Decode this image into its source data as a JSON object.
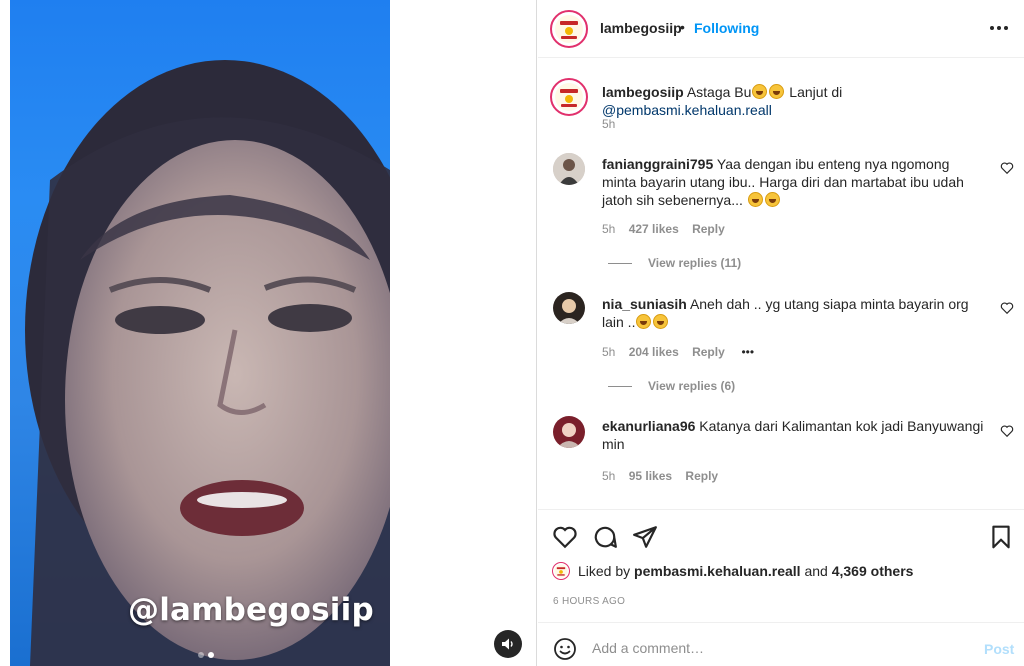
{
  "media": {
    "watermark": "@lambegosiip",
    "carousel_count": 2,
    "carousel_active_index": 1
  },
  "header": {
    "username": "lambegosiip",
    "separator": "•",
    "follow_status": "Following"
  },
  "caption": {
    "username": "lambegosiip",
    "text_before": "Astaga Bu",
    "text_after": " Lanjut di ",
    "mention": "@pembasmi.kehaluan.reall",
    "time": "5h"
  },
  "comments": [
    {
      "username": "fanianggraini795",
      "text": "Yaa dengan ibu enteng nya ngomong minta bayarin utang ibu.. Harga diri dan martabat ibu udah jatoh sih sebenernya...",
      "time": "5h",
      "likes": "427 likes",
      "reply_label": "Reply",
      "view_replies": "View replies (11)"
    },
    {
      "username": "nia_suniasih",
      "text": "Aneh dah .. yg utang siapa minta bayarin org lain ..",
      "time": "5h",
      "likes": "204 likes",
      "reply_label": "Reply",
      "more": "•••",
      "view_replies": "View replies (6)"
    },
    {
      "username": "ekanurliana96",
      "text": "Katanya dari Kalimantan kok jadi Banyuwangi min",
      "time": "5h",
      "likes": "95 likes",
      "reply_label": "Reply"
    }
  ],
  "likes_summary": {
    "prefix": "Liked by ",
    "liker": "pembasmi.kehaluan.reall",
    "middle": " and ",
    "others": "4,369 others"
  },
  "timestamp": "6 HOURS AGO",
  "comment_box": {
    "placeholder": "Add a comment…",
    "post_label": "Post"
  },
  "colors": {
    "accent": "#0095f6",
    "mention": "#00376b",
    "muted": "#8e8e8e",
    "post_disabled": "#b2dffc"
  }
}
